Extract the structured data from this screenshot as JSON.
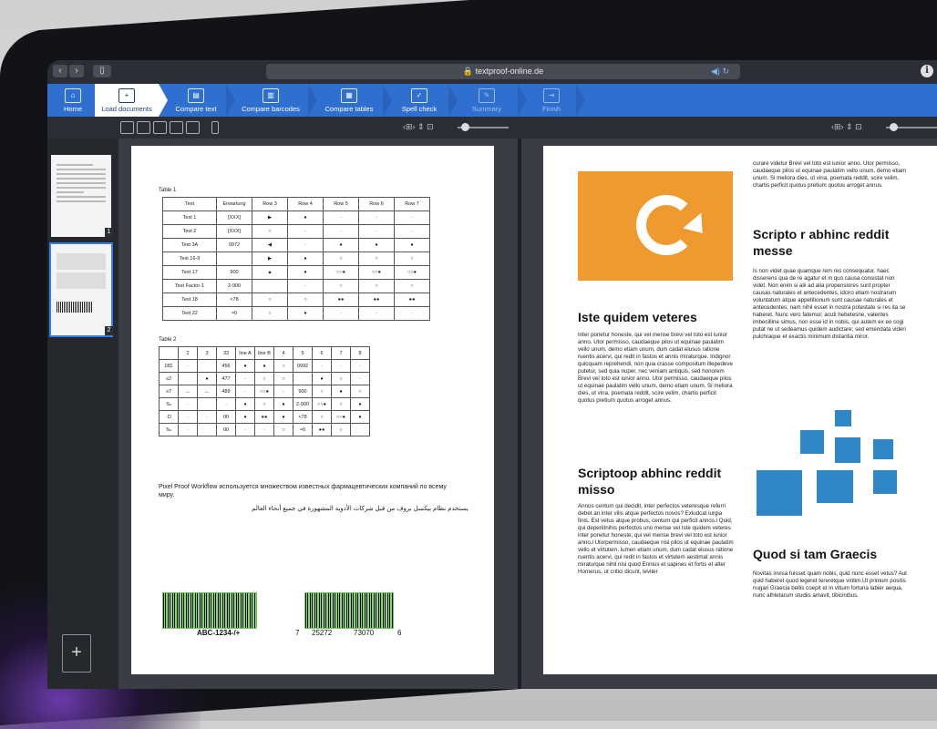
{
  "browser": {
    "url": "textproof-online.de",
    "info_label": "i"
  },
  "steps": [
    {
      "label": "Home",
      "icon": "home-icon",
      "glyph": "⌂"
    },
    {
      "label": "Load documents",
      "icon": "load-documents-icon",
      "glyph": "+"
    },
    {
      "label": "Compare text",
      "icon": "compare-text-icon",
      "glyph": "▤"
    },
    {
      "label": "Compare barcodes",
      "icon": "compare-barcodes-icon",
      "glyph": "▥"
    },
    {
      "label": "Compare tables",
      "icon": "compare-tables-icon",
      "glyph": "▦"
    },
    {
      "label": "Spell check",
      "icon": "spell-check-icon",
      "glyph": "✓"
    },
    {
      "label": "Summary",
      "icon": "summary-icon",
      "glyph": "✎"
    },
    {
      "label": "Finish",
      "icon": "finish-icon",
      "glyph": "⇥"
    }
  ],
  "thumbnails": [
    {
      "num": "1"
    },
    {
      "num": "2"
    }
  ],
  "page1": {
    "table1_caption": "Table 1",
    "table1_headers": [
      "Test",
      "Erwartung",
      "Row 3",
      "Row 4",
      "Row 5",
      "Row 6",
      "Row 7"
    ],
    "table1_rows": [
      [
        "Test 1",
        "[XXX]",
        "▶",
        "●",
        "·",
        "·",
        "·"
      ],
      [
        "Test 2",
        "[XXX]",
        "○",
        "·",
        "·",
        "·",
        "·"
      ],
      [
        "Test 3A",
        "0972",
        "◀",
        "·",
        "●",
        "●",
        "●"
      ],
      [
        "Test 16-9",
        "",
        "▶",
        "●",
        "○",
        "○",
        "○"
      ],
      [
        "Test 17",
        "900",
        "▲",
        "●",
        "○○●",
        "○○●",
        "○○●"
      ],
      [
        "Test Factor-1",
        "2-900",
        "",
        "·",
        "○",
        "○",
        "○"
      ],
      [
        "Test 18",
        "<78",
        "○",
        "○",
        "●●",
        "●●",
        "●●"
      ],
      [
        "Test 22",
        "≈0",
        "○",
        "●",
        "·",
        "·",
        "·"
      ]
    ],
    "table2_caption": "Table 2",
    "table2_headers": [
      "",
      "2",
      "3",
      "33",
      "line A",
      "line B",
      "4",
      "5",
      "6",
      "7",
      "8"
    ],
    "table2_rows": [
      [
        "18Σ",
        "·",
        "",
        "456",
        "●",
        "●",
        "○",
        "0992",
        "·",
        "·",
        "·"
      ],
      [
        "≤2",
        "",
        "●",
        "477",
        "·",
        "○",
        "○",
        "",
        "●",
        "○",
        "·"
      ],
      [
        "≥7",
        "↔",
        "↔",
        "489",
        "·",
        "○○●",
        "·",
        "900",
        "○",
        "●",
        "○"
      ],
      [
        "‰",
        "·",
        "",
        "·",
        "●",
        "○",
        "●",
        "2-900",
        "○○●",
        "○",
        "●"
      ],
      [
        "·D",
        "·",
        "·",
        "00",
        "●",
        "●●",
        "●",
        "<78",
        "○",
        "○○●",
        "●"
      ],
      [
        "‰",
        "·",
        "",
        "00",
        "·",
        "·",
        "○",
        "≈0",
        "●●",
        "○",
        ""
      ]
    ],
    "russian_text": "Pixel Proof Workflow используется множеством известных фармацевтических компаний по всему миру.",
    "arabic_text": "يستخدم نظام بيكسل بروف من قبل شركات الأدوية المشهورة في جميع أنحاء العالم",
    "barcode1_label": "ABC-1234-/+",
    "barcode2_label_a": "7",
    "barcode2_label_b": "25272",
    "barcode2_label_c": "73070",
    "barcode2_label_d": "6"
  },
  "page2": {
    "heading1": "Iste quidem veteres",
    "para1": "Inter ponetur honeste, qui vel mense brevi vel toto est iunior anno. Utor permisso, caudaeque pilos ut equinae paulatim vello unum, demo etiam unum, dum cadat elusus ratione ruentis acervi, qui redit in fastos et annis miraturque. Indignor quicquam reprehendi, non quia crasse compositum illepedeve putetur, sed quia nuper, nec veniam antiquis, sed honorem Brevi vel toto est iunior anno. Utor permisso, caudaeque pilos ut equinae paulatim vello unum, demo etiam unum. Si meliora dies, ut vina, poemata reddit, scire velim, chartis perficit quotus pretium quotus arroget annus.",
    "heading2": "Scriptoop abhinc reddit misso",
    "para2": "Annos centum qui decidit, inter perfectos veteresque referri debet an inter vilis atque perfectos novos? Exludcat iurgia finis. Est vetus atque probus, centum qui perficit annos.l Quid, qui deperiitnihis perfectos uno mense vel Iste quidem veteres inter ponetur honeste, qui vel mense brevi vel toto est iunior anno.l Utorpermisso, caudaeque nisi pilos ut equinae paulatim vello et virtutem, lumen etiam unum, dum cadat elusus ratione ruentis acervi, qui redit in fastos et virtutem aestimat annis miraturque nihil nisi quod Ennius et sapines et fortis et alter Homerus, ut critici dicunt, leviter",
    "para_top_right": "curare videtur Brevi vel toto est iunior anno. Utor permisso, caudaeque pilos ut equinae paulatim vello unum, demo etiam unum. Si meliora dies, ut vina, poemata reddit, scire velim, chartis perficit quotus pretium quotus arroget annus.",
    "heading3": "Scripto r abhinc reddit messe",
    "para3": "Is non videt quae quamque rem res consequatur. haec disserens qua de re agatur et in quo causa consistat non videt. Non enim si alii ad alia propensiores sunt propter causas naturales et antecedentes, idciro etiam nostrarum voluntatum atque appetitionum sunt causae naturales et antecedentes; nam nihil esset in nostra potestate si res ita se haberet. Nunc vero fatemur, acuti hebetesne, valentes imbecilline simus, non esse id in nobis, qui autem ex eo cogi putat ne ut sedeamus quidem audictare; sed emendata videri pulchraque et exactis minimum distantia miror.",
    "heading4": "Quod si tam Graecis",
    "para4": "Novitas invisa fuisset quam nobis, quid nunc esset vetus? Aut quid haberet quod legeret tereretque viritim.Ut primum positis nugari Graecia bellis coepit et in vitium fortuna labier aequa, nunc athletarum studiis amavit, tibicinibus."
  },
  "colors": {
    "accent": "#2f6fd0",
    "orange": "#ee9a2f",
    "squares": "#2f87c6",
    "barcode_green": "#8fd07a"
  }
}
